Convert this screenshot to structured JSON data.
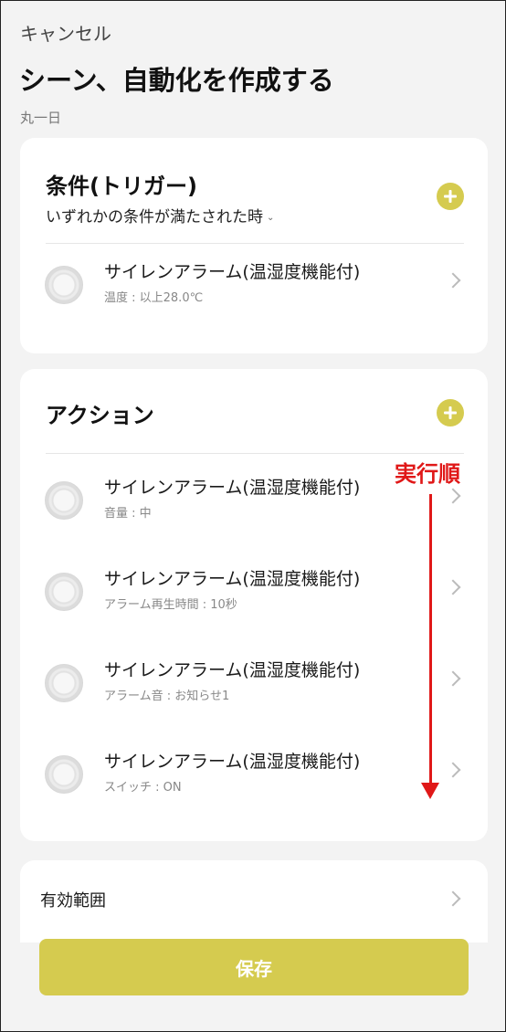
{
  "header": {
    "cancel_label": "キャンセル",
    "title": "シーン、自動化を作成する",
    "subtitle": "丸一日"
  },
  "conditions": {
    "heading": "条件(トリガー)",
    "match_mode": "いずれかの条件が満たされた時",
    "items": [
      {
        "title": "サイレンアラーム(温湿度機能付)",
        "detail": "温度 : 以上28.0℃"
      }
    ]
  },
  "actions": {
    "heading": "アクション",
    "items": [
      {
        "title": "サイレンアラーム(温湿度機能付)",
        "detail": "音量 : 中"
      },
      {
        "title": "サイレンアラーム(温湿度機能付)",
        "detail": "アラーム再生時間 : 10秒"
      },
      {
        "title": "サイレンアラーム(温湿度機能付)",
        "detail": "アラーム音 : お知らせ1"
      },
      {
        "title": "サイレンアラーム(温湿度機能付)",
        "detail": "スイッチ : ON"
      }
    ]
  },
  "scope": {
    "label": "有効範囲"
  },
  "annotation": {
    "label": "実行順"
  },
  "footer": {
    "save_label": "保存"
  },
  "colors": {
    "accent": "#d5cb4f",
    "annotation": "#e01818",
    "background": "#f3f3f3"
  },
  "icons": {
    "add": "plus-circle-icon",
    "device": "siren-device-icon",
    "row_nav": "chevron-right-icon",
    "dropdown": "chevron-down-icon"
  }
}
